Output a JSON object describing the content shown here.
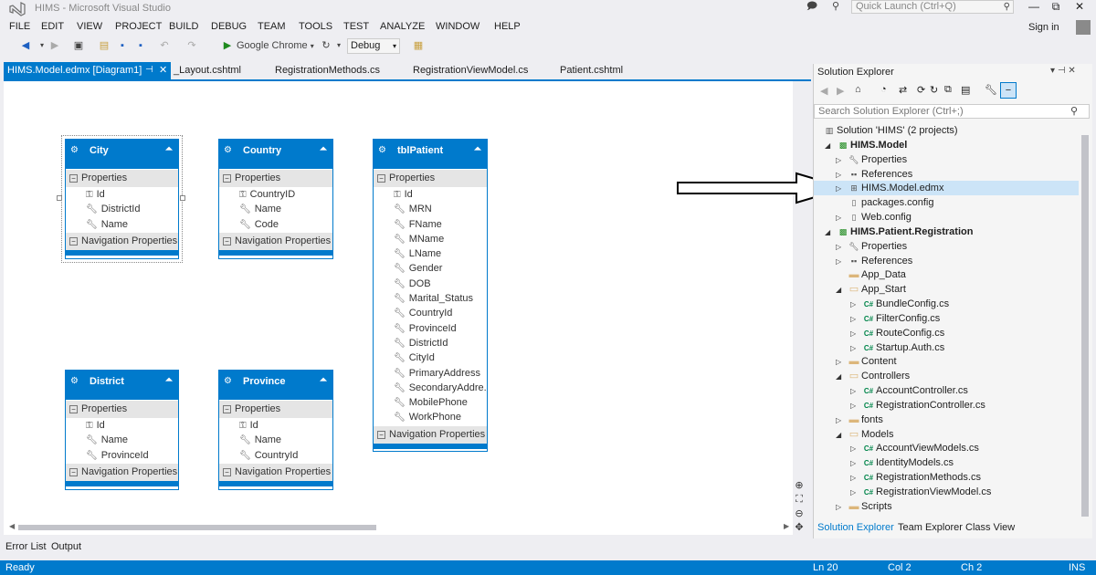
{
  "window": {
    "title": "HIMS - Microsoft Visual Studio"
  },
  "quick_launch": {
    "placeholder": "Quick Launch (Ctrl+Q)"
  },
  "window_controls": {
    "minimize": "—",
    "restore": "⧉",
    "close": "✕"
  },
  "menu": [
    "FILE",
    "EDIT",
    "VIEW",
    "PROJECT",
    "BUILD",
    "DEBUG",
    "TEAM",
    "TOOLS",
    "TEST",
    "ANALYZE",
    "WINDOW",
    "HELP"
  ],
  "account": {
    "signin": "Sign in"
  },
  "toolbar": {
    "browser": "Google Chrome",
    "config": "Debug"
  },
  "tabs": {
    "active": "HIMS.Model.edmx [Diagram1]",
    "others": [
      "_Layout.cshtml",
      "RegistrationMethods.cs",
      "RegistrationViewModel.cs",
      "Patient.cshtml"
    ]
  },
  "entities": {
    "city": {
      "name": "City",
      "props": [
        "Id",
        "DistrictId",
        "Name"
      ]
    },
    "country": {
      "name": "Country",
      "props": [
        "CountryID",
        "Name",
        "Code"
      ]
    },
    "patient": {
      "name": "tblPatient",
      "props": [
        "Id",
        "MRN",
        "FName",
        "MName",
        "LName",
        "Gender",
        "DOB",
        "Marital_Status",
        "CountryId",
        "ProvinceId",
        "DistrictId",
        "CityId",
        "PrimaryAddress",
        "SecondaryAddre...",
        "MobilePhone",
        "WorkPhone"
      ]
    },
    "district": {
      "name": "District",
      "props": [
        "Id",
        "Name",
        "ProvinceId"
      ]
    },
    "province": {
      "name": "Province",
      "props": [
        "Id",
        "Name",
        "CountryId"
      ]
    },
    "section_properties": "Properties",
    "section_navigation": "Navigation Properties"
  },
  "bottom_tabs": [
    "Error List",
    "Output"
  ],
  "status": {
    "ready": "Ready",
    "ln": "Ln 20",
    "col": "Col 2",
    "ch": "Ch 2",
    "ins": "INS"
  },
  "solution_explorer": {
    "title": "Solution Explorer",
    "search_placeholder": "Search Solution Explorer (Ctrl+;)",
    "tree": [
      {
        "label": "Solution 'HIMS' (2 projects)",
        "bold": false
      },
      {
        "label": "HIMS.Model",
        "bold": true
      },
      {
        "label": "Properties",
        "bold": false
      },
      {
        "label": "References",
        "bold": false
      },
      {
        "label": "HIMS.Model.edmx",
        "bold": false
      },
      {
        "label": "packages.config",
        "bold": false
      },
      {
        "label": "Web.config",
        "bold": false
      },
      {
        "label": "HIMS.Patient.Registration",
        "bold": true
      },
      {
        "label": "Properties",
        "bold": false
      },
      {
        "label": "References",
        "bold": false
      },
      {
        "label": "App_Data",
        "bold": false
      },
      {
        "label": "App_Start",
        "bold": false
      },
      {
        "label": "BundleConfig.cs",
        "bold": false
      },
      {
        "label": "FilterConfig.cs",
        "bold": false
      },
      {
        "label": "RouteConfig.cs",
        "bold": false
      },
      {
        "label": "Startup.Auth.cs",
        "bold": false
      },
      {
        "label": "Content",
        "bold": false
      },
      {
        "label": "Controllers",
        "bold": false
      },
      {
        "label": "AccountController.cs",
        "bold": false
      },
      {
        "label": "RegistrationController.cs",
        "bold": false
      },
      {
        "label": "fonts",
        "bold": false
      },
      {
        "label": "Models",
        "bold": false
      },
      {
        "label": "AccountViewModels.cs",
        "bold": false
      },
      {
        "label": "IdentityModels.cs",
        "bold": false
      },
      {
        "label": "RegistrationMethods.cs",
        "bold": false
      },
      {
        "label": "RegistrationViewModel.cs",
        "bold": false
      },
      {
        "label": "Scripts",
        "bold": false
      }
    ],
    "bottom_tabs": [
      "Solution Explorer",
      "Team Explorer",
      "Class View"
    ]
  },
  "colors": {
    "accent": "#007acc",
    "background": "#eeeef2"
  }
}
